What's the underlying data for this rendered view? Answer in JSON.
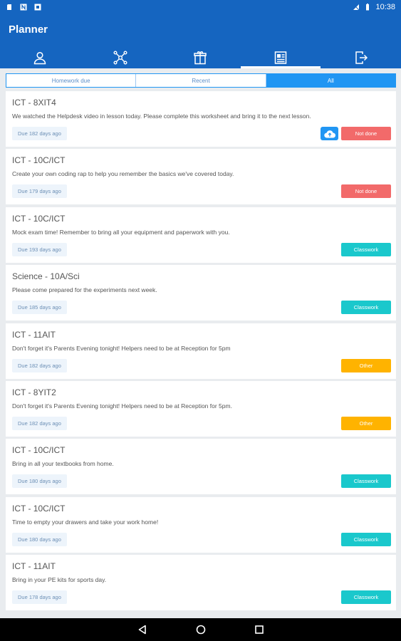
{
  "status_bar": {
    "time": "10:38",
    "left_icons": [
      "sd-card-icon",
      "n-notification-icon",
      "download-notification-icon"
    ],
    "right_icons": [
      "signal-off-icon",
      "battery-icon"
    ]
  },
  "app": {
    "title": "Planner"
  },
  "tabs": [
    {
      "name": "profile",
      "icon": "person-icon",
      "active": false
    },
    {
      "name": "network",
      "icon": "network-icon",
      "active": false
    },
    {
      "name": "gift",
      "icon": "gift-icon",
      "active": false
    },
    {
      "name": "planner",
      "icon": "planner-icon",
      "active": true
    },
    {
      "name": "logout",
      "icon": "exit-icon",
      "active": false
    }
  ],
  "filters": [
    {
      "label": "Homework due",
      "active": false
    },
    {
      "label": "Recent",
      "active": false
    },
    {
      "label": "All",
      "active": true
    }
  ],
  "colors": {
    "primary": "#1565c0",
    "accent": "#2196f3",
    "not_done": "#f26a6a",
    "classwork": "#1ac8cc",
    "other": "#ffb300"
  },
  "items": [
    {
      "subject": "ICT - 8XIT4",
      "description": "We watched the Helpdesk video in lesson today. Please complete this worksheet and bring it to the next lesson.",
      "due": "Due 182 days ago",
      "status": "Not done",
      "status_type": "not_done",
      "has_upload": true
    },
    {
      "subject": "ICT - 10C/ICT",
      "description": "Create your own coding rap to help you remember the basics we've covered today.",
      "due": "Due 179 days ago",
      "status": "Not done",
      "status_type": "not_done",
      "has_upload": false
    },
    {
      "subject": "ICT - 10C/ICT",
      "description": "Mock exam time! Remember to bring all your equipment and paperwork with you.",
      "due": "Due 193 days ago",
      "status": "Classwork",
      "status_type": "classwork",
      "has_upload": false
    },
    {
      "subject": "Science - 10A/Sci",
      "description": "Please come prepared for the experiments next week.",
      "due": "Due 185 days ago",
      "status": "Classwork",
      "status_type": "classwork",
      "has_upload": false
    },
    {
      "subject": "ICT - 11AIT",
      "description": "Don't forget it's Parents Evening tonight! Helpers need to be at Reception for 5pm",
      "due": "Due 182 days ago",
      "status": "Other",
      "status_type": "other",
      "has_upload": false
    },
    {
      "subject": "ICT - 8YIT2",
      "description": "Don't forget it's Parents Evening tonight! Helpers need to be at Reception for 5pm.",
      "due": "Due 182 days ago",
      "status": "Other",
      "status_type": "other",
      "has_upload": false
    },
    {
      "subject": "ICT - 10C/ICT",
      "description": "Bring in all your textbooks from home.",
      "due": "Due 180 days ago",
      "status": "Classwork",
      "status_type": "classwork",
      "has_upload": false
    },
    {
      "subject": "ICT - 10C/ICT",
      "description": "Time to empty your drawers and take your work home!",
      "due": "Due 180 days ago",
      "status": "Classwork",
      "status_type": "classwork",
      "has_upload": false
    },
    {
      "subject": "ICT - 11AIT",
      "description": "Bring in your PE kits for sports day.",
      "due": "Due 178 days ago",
      "status": "Classwork",
      "status_type": "classwork",
      "has_upload": false
    }
  ],
  "nav": {
    "back_icon": "back-icon",
    "home_icon": "home-icon",
    "recents_icon": "recents-icon"
  }
}
